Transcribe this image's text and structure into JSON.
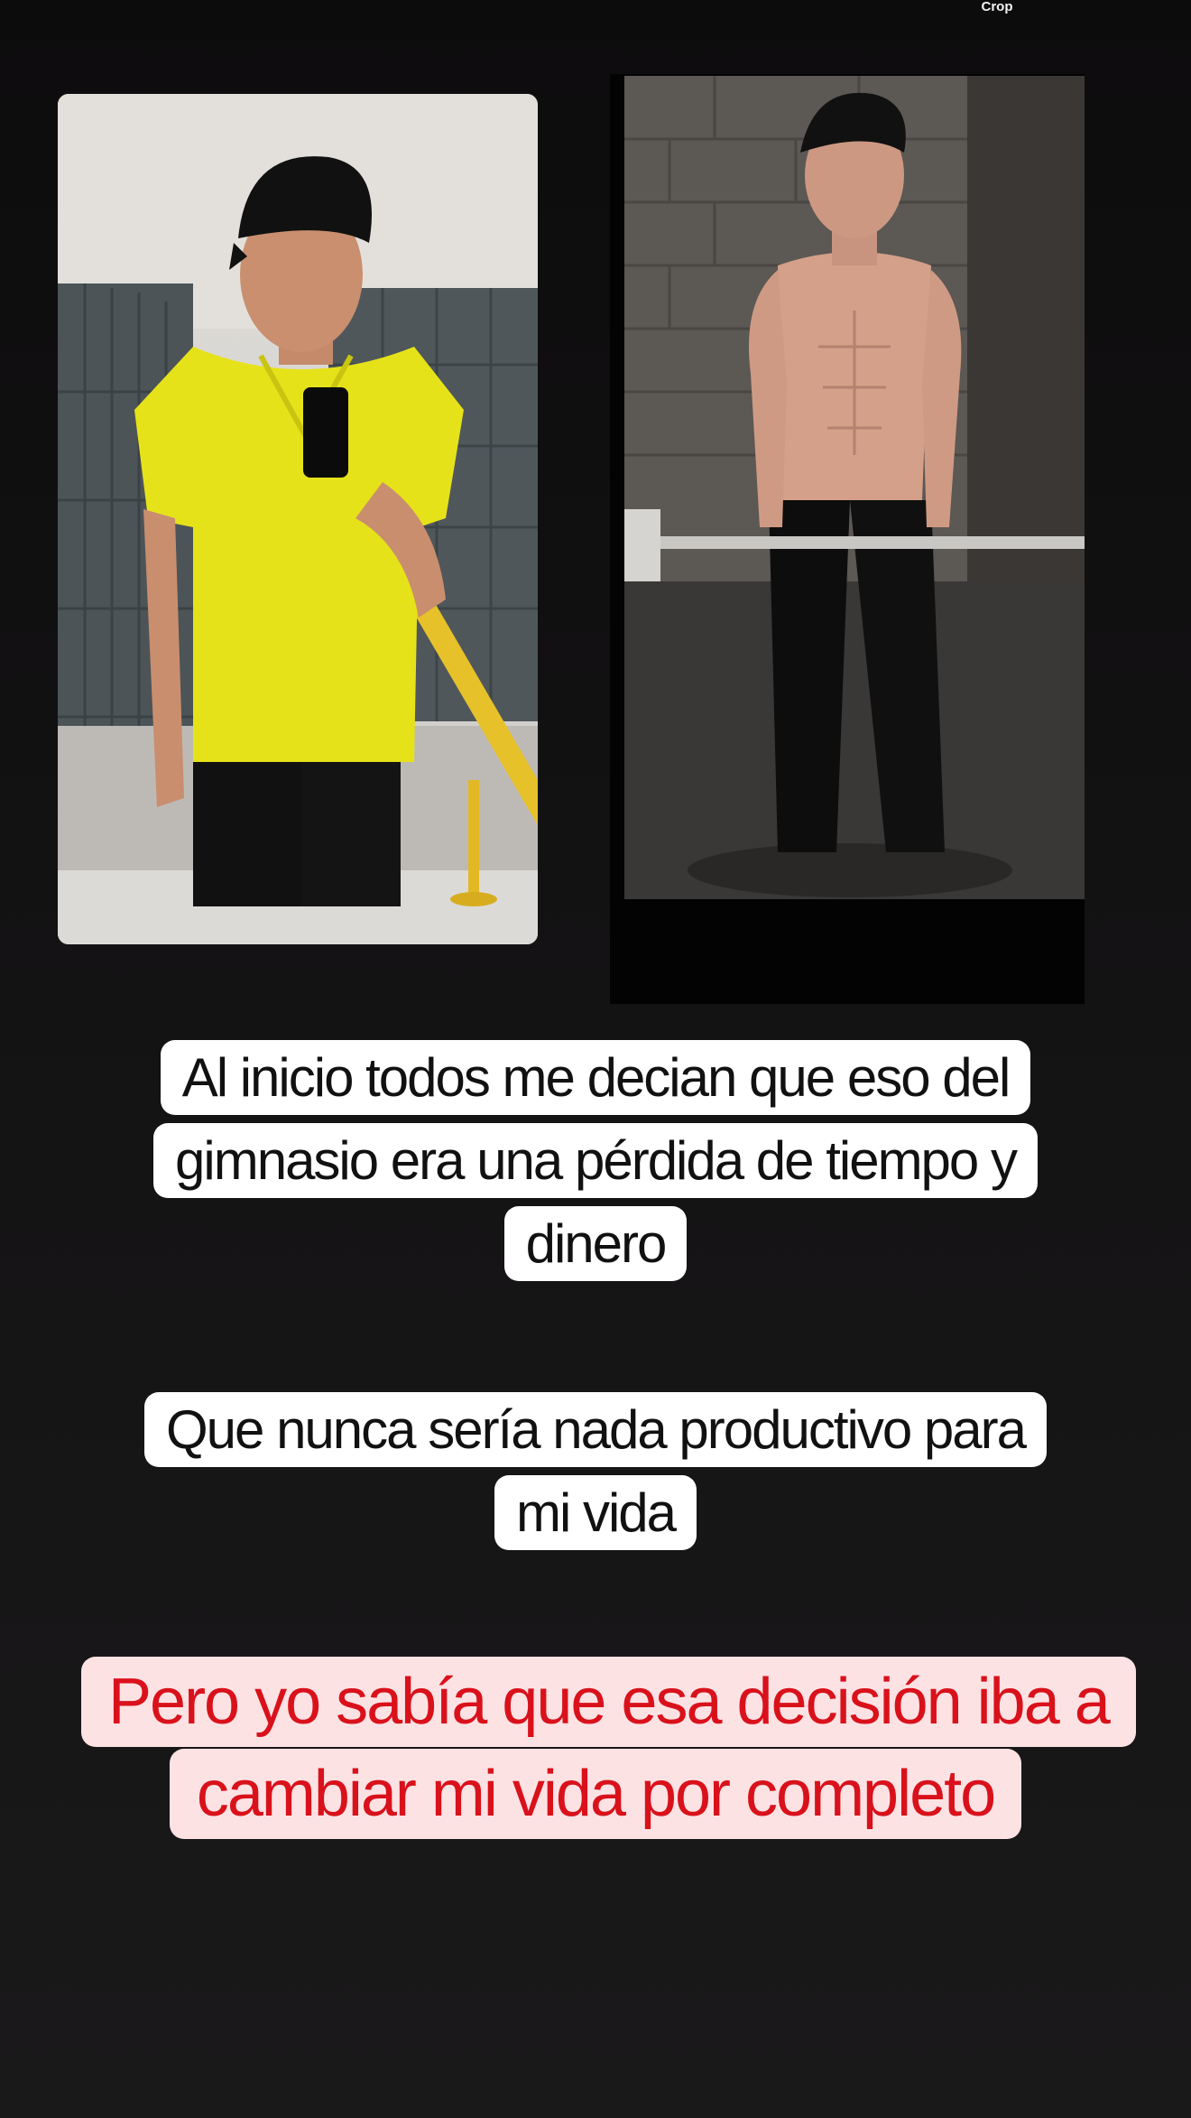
{
  "top_chip": {
    "label": "Crop"
  },
  "photos": {
    "before": {
      "description_icon": "before-photo-yellow-shirt-locker-room"
    },
    "after": {
      "description_icon": "after-photo-shirtless-barbell"
    }
  },
  "captions": [
    {
      "text": "Al inicio todos me decian que eso del gimnasio era una pérdida de tiempo y dinero"
    },
    {
      "text": "Que nunca sería nada productivo para mi vida"
    },
    {
      "text": "Pero yo sabía que esa decisión iba a cambiar mi vida por completo"
    }
  ],
  "colors": {
    "background": "#141314",
    "caption_bg": "#ffffff",
    "highlight_bg": "#fde2e4",
    "highlight_text": "#d9111b",
    "shirt_yellow": "#e6e21a"
  }
}
